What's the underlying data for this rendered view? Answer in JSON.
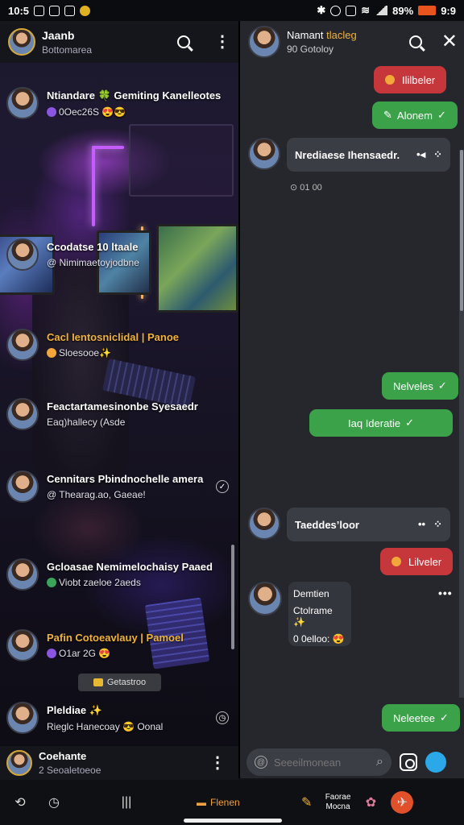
{
  "status_bar": {
    "time": "10:5",
    "battery": "89%",
    "right_time": "9:9"
  },
  "left": {
    "header": {
      "name": "Jaanb",
      "subtitle": "Bottomarea"
    },
    "chats": [
      {
        "title": "Ntiandare 🍀 Gemiting Kanelleotes",
        "subtitle": "0Oec26S 😍😎"
      },
      {
        "title": "Ccodatse 10 ltaale",
        "subtitle": "@ Nimimaetoyjodbne"
      },
      {
        "title": "Cacl Ientosniclidal | Panoe",
        "subtitle": "Sloesooe✨"
      },
      {
        "title": "Feactartamesinonbe Syesaedr",
        "subtitle": "Eaq)hallecy (Asde"
      },
      {
        "title": "Cennitars Pbindnochelle amera",
        "subtitle": "@ Thearag.ao, Gaeae!"
      },
      {
        "title": "Gcloasae Nemimelochaisy Paaed",
        "subtitle": "Viobt zaeloe 2aeds"
      },
      {
        "title": "Pafin Cotoeavlauy | Pamoel",
        "subtitle": "O1ar 2G 😍"
      },
      {
        "title": "Pleldiae ✨",
        "subtitle": "Rieglc Hanecoay 😎 Oonal"
      }
    ],
    "archived_label": "Getastroo",
    "footer": {
      "name": "Coehante",
      "subtitle": "2 Seoaletoeoe"
    }
  },
  "right": {
    "header": {
      "name": "Namant",
      "name_accent": "tlacleg",
      "subtitle": "90 Gotoloy"
    },
    "messages": [
      {
        "kind": "pill-red",
        "text": "Ililbeler"
      },
      {
        "kind": "pill-green",
        "text": "Alonem"
      },
      {
        "kind": "bubble",
        "text": "Nrediaese Ihensaedr."
      },
      {
        "kind": "meta",
        "text": "⊙ 01 00"
      },
      {
        "kind": "pill-green",
        "text": "Nelveles"
      },
      {
        "kind": "pill-green",
        "text": "Iaq Ideratie"
      },
      {
        "kind": "bubble",
        "text": "Taeddes’loor"
      },
      {
        "kind": "pill-red",
        "text": "Lilveler"
      },
      {
        "kind": "card",
        "line1": "Demtien",
        "line2": "Ctolrame ✨",
        "line3": "0 0elloo: 😍"
      },
      {
        "kind": "pill-green",
        "text": "Neleetee"
      }
    ],
    "composer_placeholder": "Seeeilmonean"
  },
  "bottom_nav": {
    "center_label": "Flenen",
    "right_label_1": "Faorae",
    "right_label_2": "Mocna"
  }
}
